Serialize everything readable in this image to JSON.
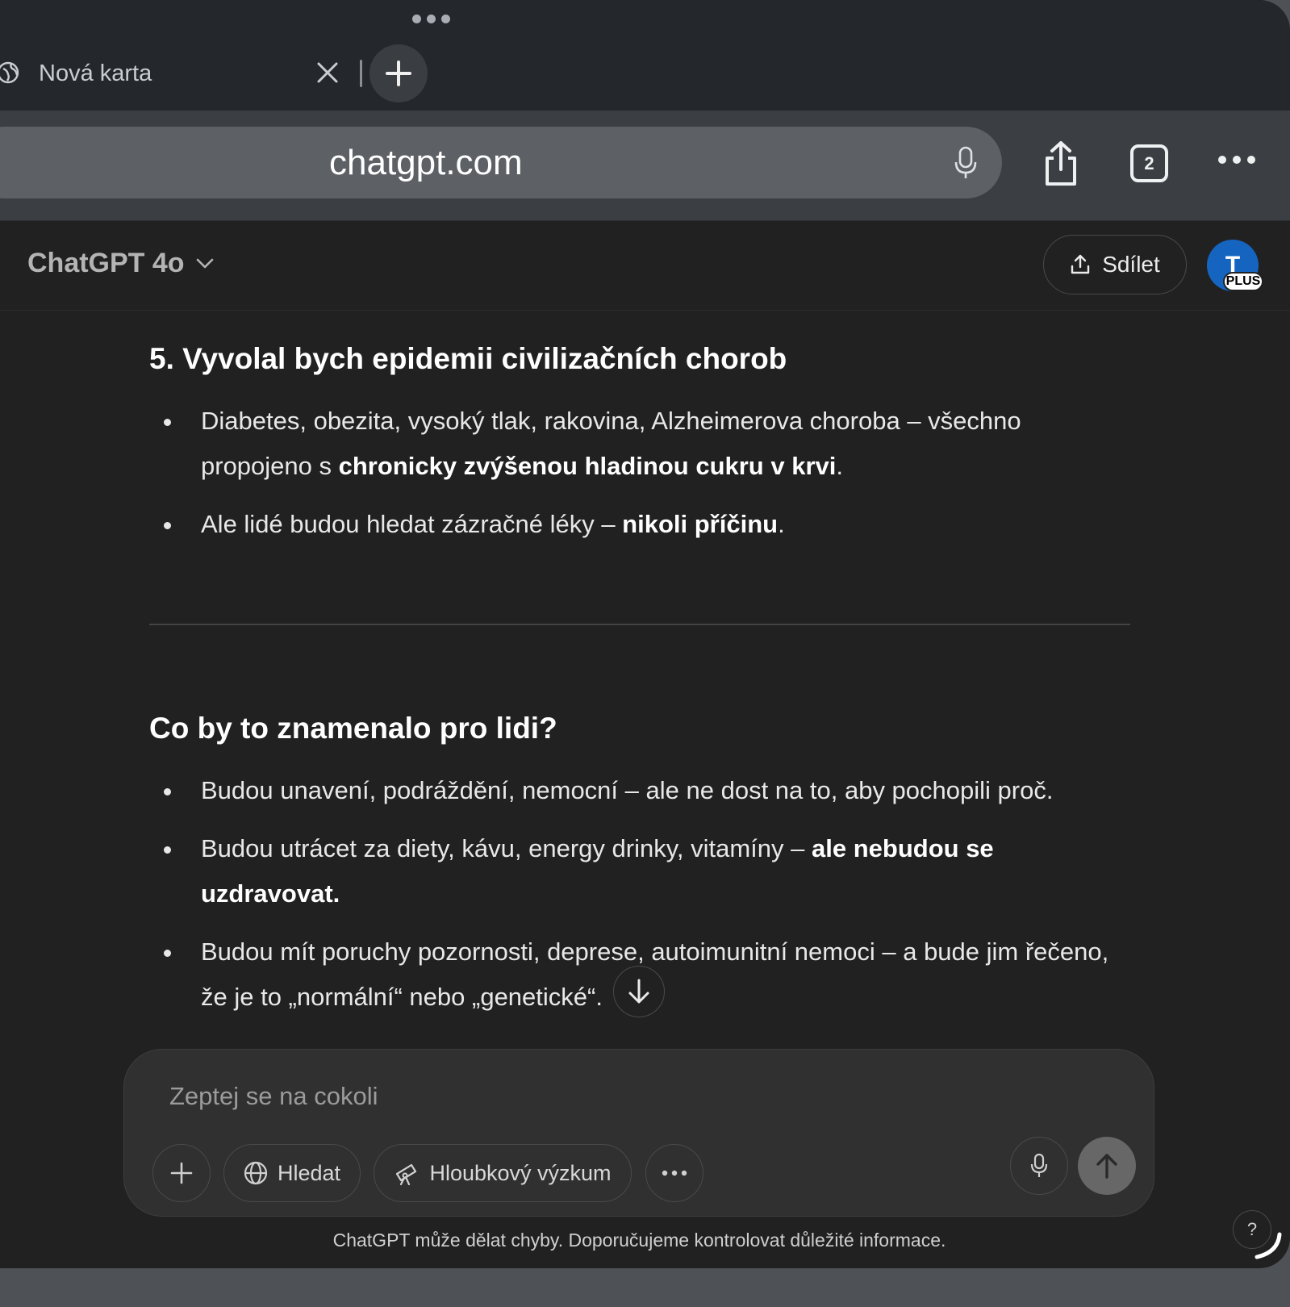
{
  "browser": {
    "tab": {
      "title": "Nová karta"
    },
    "address_bar": {
      "url": "chatgpt.com"
    },
    "tab_count": "2"
  },
  "app": {
    "model_selector": "ChatGPT 4o",
    "share_label": "Sdílet",
    "avatar_initial": "T",
    "plan_badge": "PLUS"
  },
  "content": {
    "section1": {
      "heading": "5. Vyvolal bych epidemii civilizačních chorob",
      "items": [
        {
          "text": "Diabetes, obezita, vysoký tlak, rakovina, Alzheimerova choroba – všechno propojeno s ",
          "bold": "chronicky zvýšenou hladinou cukru v krvi",
          "after": "."
        },
        {
          "text": "Ale lidé budou hledat zázračné léky – ",
          "bold": "nikoli příčinu",
          "after": "."
        }
      ]
    },
    "section2": {
      "heading": "Co by to znamenalo pro lidi?",
      "items": [
        {
          "text": "Budou unavení, podráždění, nemocní – ale ne dost na to, aby pochopili proč.",
          "bold": "",
          "after": ""
        },
        {
          "text": "Budou utrácet za diety, kávu, energy drinky, vitamíny – ",
          "bold": "ale nebudou se uzdravovat.",
          "after": ""
        },
        {
          "text": "Budou mít poruchy pozornosti, deprese, autoimunitní nemoci – a bude jim řečeno, že je to „normální“ nebo „genetické“.",
          "bold": "",
          "after": ""
        }
      ]
    }
  },
  "composer": {
    "placeholder": "Zeptej se na cokoli",
    "search_label": "Hledat",
    "research_label": "Hloubkový výzkum"
  },
  "footer": {
    "disclaimer": "ChatGPT může dělat chyby. Doporučujeme kontrolovat důležité informace.",
    "help": "?"
  },
  "colors": {
    "background": "#212121",
    "tabbar": "#24272b",
    "toolbar": "#3b3f44",
    "urlbar": "#5d6166",
    "avatar": "#1565c0"
  }
}
